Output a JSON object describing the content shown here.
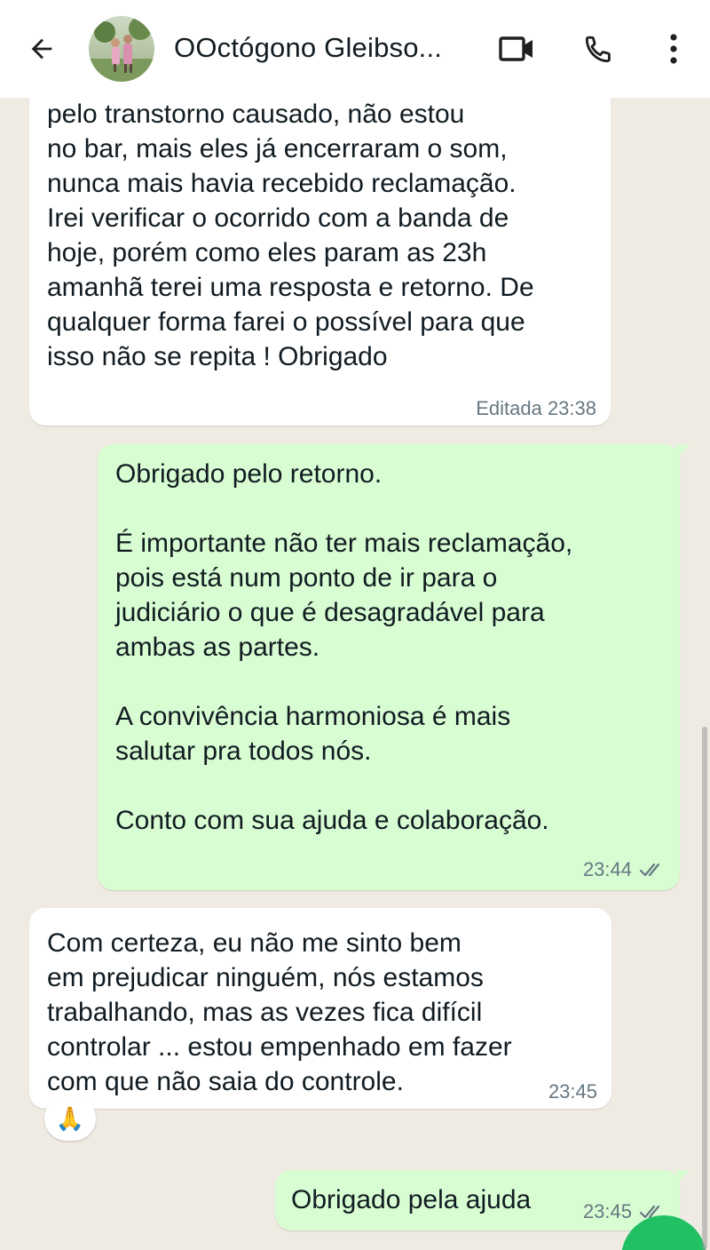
{
  "header": {
    "contact_name": "OOctógono Gleibso..."
  },
  "icons": {
    "back": "arrow-left-icon",
    "video": "video-camera-icon",
    "call": "phone-icon",
    "menu": "more-vertical-icon",
    "ticks": "double-check-icon",
    "reaction": "folded-hands-emoji"
  },
  "colors": {
    "incoming_bubble": "#ffffff",
    "outgoing_bubble": "#d9fdd3",
    "chat_background": "#efeae2",
    "meta_text": "#667781",
    "fab": "#21c063"
  },
  "messages": [
    {
      "direction": "incoming",
      "text": "Boa noite Dr Marcelo, peço desculpas\npelo transtorno causado, não estou\nno bar, mais eles já encerraram o som,\nnunca mais havia recebido reclamação.\nIrei verificar o ocorrido com a banda de\nhoje, porém como eles param as 23h\namanhã terei uma resposta e retorno. De\nqualquer forma farei o possível para que\nisso não se repita ! Obrigado",
      "time": "Editada 23:38"
    },
    {
      "direction": "outgoing",
      "text": "Obrigado pelo retorno.\n\nÉ importante não ter mais reclamação,\npois está num ponto de ir para o\njudiciário o que é desagradável para\nambas as partes.\n\nA convivência harmoniosa é mais\nsalutar pra todos nós.\n\nConto com sua ajuda e colaboração.",
      "time": "23:44"
    },
    {
      "direction": "incoming",
      "text": "Com certeza, eu não me sinto bem\nem prejudicar ninguém, nós estamos\ntrabalhando, mas as vezes fica difícil\ncontrolar ... estou empenhado em fazer\ncom que não saia do controle.",
      "time": "23:45",
      "reaction": "🙏"
    },
    {
      "direction": "outgoing",
      "text": "Obrigado pela ajuda",
      "time": "23:45"
    }
  ]
}
